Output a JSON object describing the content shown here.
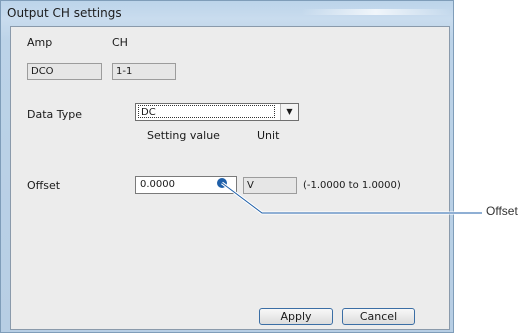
{
  "window": {
    "title": "Output CH settings"
  },
  "amp": {
    "label": "Amp",
    "value": "DCO"
  },
  "ch": {
    "label": "CH",
    "value": "1-1"
  },
  "data_type": {
    "label": "Data Type",
    "selected": "DC"
  },
  "columns": {
    "setting_value": "Setting value",
    "unit": "Unit"
  },
  "offset": {
    "label": "Offset",
    "value": "0.0000",
    "unit": "V",
    "range": "(-1.0000 to 1.0000)"
  },
  "buttons": {
    "apply": "Apply",
    "cancel": "Cancel"
  },
  "callout": {
    "label": "Offset",
    "color": "#1f5fa8"
  },
  "icons": {
    "dropdown": "chevron-down-icon"
  }
}
